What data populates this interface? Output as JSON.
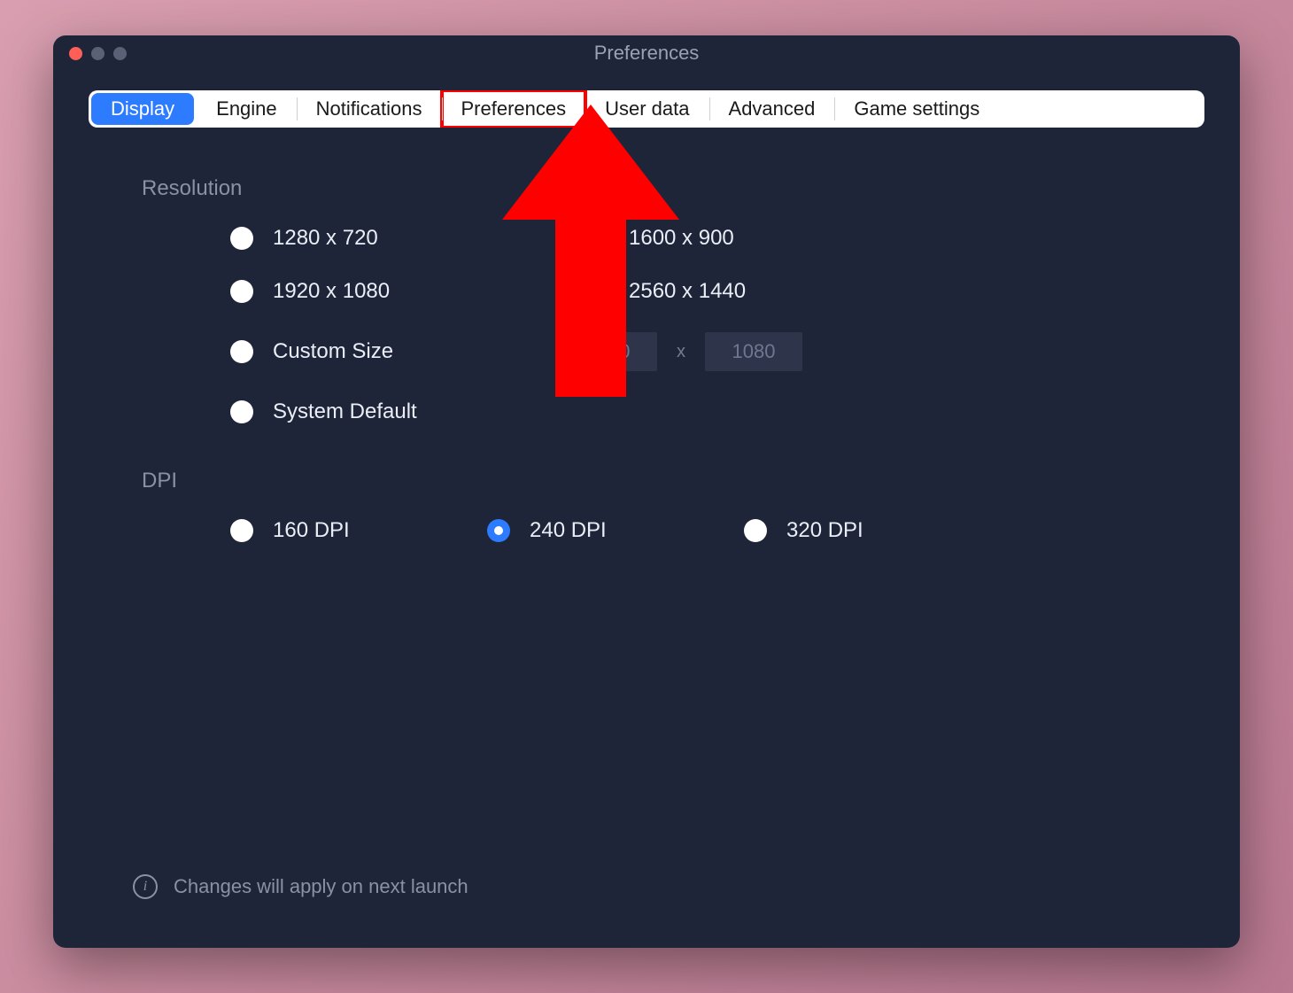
{
  "window": {
    "title": "Preferences"
  },
  "tabs": [
    {
      "label": "Display",
      "active": true
    },
    {
      "label": "Engine"
    },
    {
      "label": "Notifications"
    },
    {
      "label": "Preferences",
      "highlight": true
    },
    {
      "label": "User data"
    },
    {
      "label": "Advanced"
    },
    {
      "label": "Game settings"
    }
  ],
  "resolution": {
    "heading": "Resolution",
    "options": [
      "1280 x 720",
      "1600 x 900",
      "1920 x 1080",
      "2560 x 1440",
      "Custom Size",
      "System Default"
    ],
    "custom": {
      "width": "1920",
      "height": "1080",
      "sep": "x"
    }
  },
  "dpi": {
    "heading": "DPI",
    "options": [
      {
        "label": "160 DPI",
        "selected": false
      },
      {
        "label": "240 DPI",
        "selected": true
      },
      {
        "label": "320 DPI",
        "selected": false
      }
    ]
  },
  "footer": {
    "note": "Changes will apply on next launch"
  },
  "annotation": {
    "type": "arrow",
    "color": "#ff0000",
    "target": "tab-preferences"
  }
}
